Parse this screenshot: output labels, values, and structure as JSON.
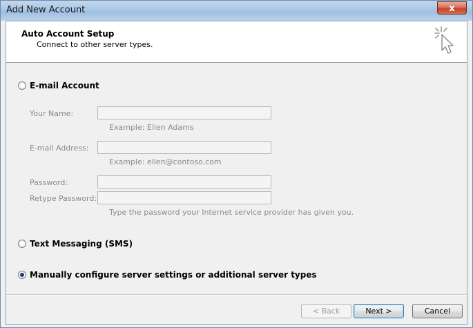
{
  "window": {
    "title": "Add New Account",
    "close_label": "x"
  },
  "header": {
    "title": "Auto Account Setup",
    "subtitle": "Connect to other server types."
  },
  "options": {
    "email_account": {
      "label": "E-mail Account",
      "selected": false
    },
    "text_messaging": {
      "label": "Text Messaging (SMS)",
      "selected": false
    },
    "manual_config": {
      "label": "Manually configure server settings or additional server types",
      "selected": true
    }
  },
  "form": {
    "your_name_label": "Your Name:",
    "your_name_value": "",
    "your_name_hint": "Example: Ellen Adams",
    "email_label": "E-mail Address:",
    "email_value": "",
    "email_hint": "Example: ellen@contoso.com",
    "password_label": "Password:",
    "password_value": "",
    "retype_label": "Retype Password:",
    "retype_value": "",
    "password_hint": "Type the password your Internet service provider has given you."
  },
  "buttons": {
    "back": "< Back",
    "next": "Next >",
    "cancel": "Cancel"
  },
  "icons": {
    "wizard": "cursor-sparkle-icon",
    "close": "close-icon"
  },
  "colors": {
    "titlebar": "#aac7e6",
    "close_button": "#c4432a",
    "radio_dot": "#1c3f84",
    "disabled_text": "#8a8a8a"
  }
}
